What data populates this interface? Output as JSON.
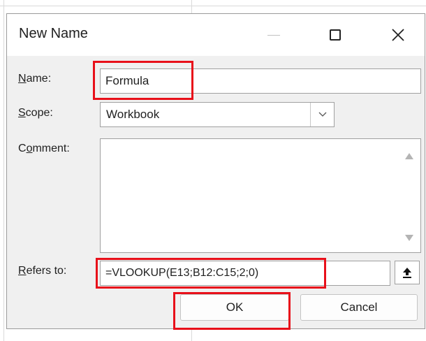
{
  "dialog": {
    "title": "New Name",
    "window_controls": {
      "minimize_icon": "minimize-icon",
      "maximize_icon": "maximize-icon",
      "close_icon": "close-icon"
    }
  },
  "form": {
    "name": {
      "label_accel": "N",
      "label_rest": "ame:",
      "value": "Formula"
    },
    "scope": {
      "label_accel": "S",
      "label_rest": "cope:",
      "value": "Workbook"
    },
    "comment": {
      "label_pre": "C",
      "label_accel": "o",
      "label_rest": "mment:",
      "value": ""
    },
    "refers_to": {
      "label_accel": "R",
      "label_rest": "efers to:",
      "value": "=VLOOKUP(E13;B12:C15;2;0)"
    }
  },
  "buttons": {
    "ok": "OK",
    "cancel": "Cancel"
  },
  "highlight_color": "#e8101a"
}
